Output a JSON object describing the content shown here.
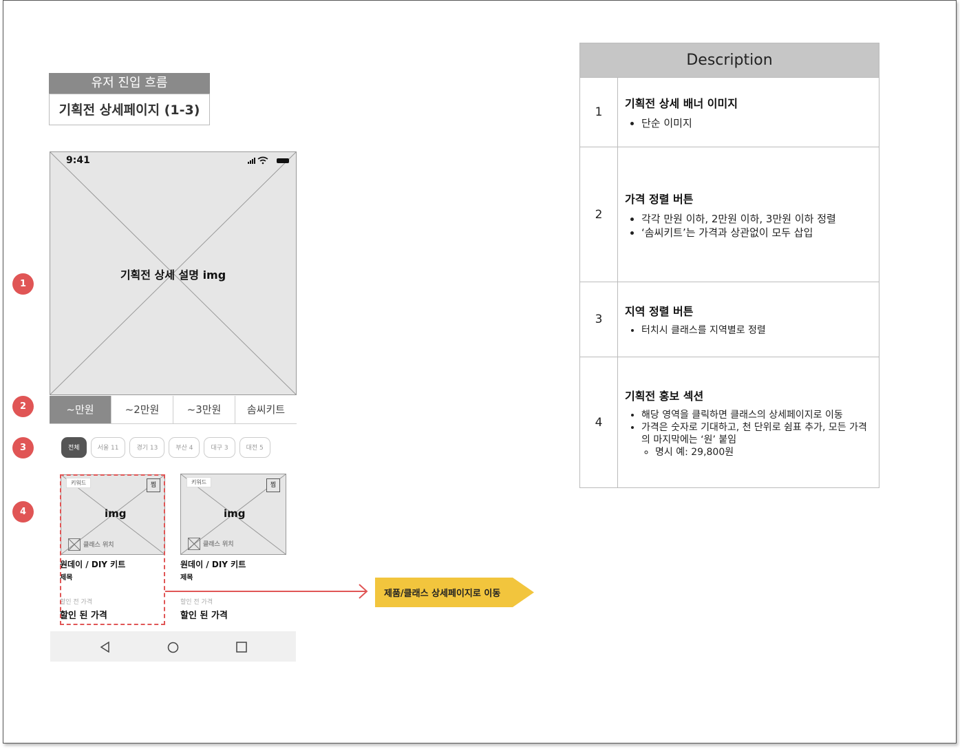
{
  "flow": {
    "header": "유저 진입 흐름",
    "page_title": "기획전 상세페이지 (1-3)"
  },
  "phone": {
    "status_time": "9:41",
    "banner_text": "기획전 상세 설명 img",
    "price_tabs": [
      "~만원",
      "~2만원",
      "~3만원",
      "솜씨키트"
    ],
    "region_chips": [
      "전체",
      "서울 11",
      "경기 13",
      "부산 4",
      "대구 3",
      "대전 5"
    ],
    "cards": [
      {
        "keyword": "키워드",
        "jjim": "찜",
        "img_text": "img",
        "location": "클래스 위치",
        "title": "원데이 / DIY 키트",
        "subtitle": "제목",
        "before_price": "할인 전 가격",
        "price": "할인 된 가격"
      },
      {
        "keyword": "키워드",
        "jjim": "찜",
        "img_text": "img",
        "location": "클래스 위치",
        "title": "원데이 / DIY 키트",
        "subtitle": "제목",
        "before_price": "할인 전 가격",
        "price": "할인 된 가격"
      }
    ],
    "nav_icons": [
      "back-icon",
      "home-icon",
      "recents-icon"
    ]
  },
  "badges": [
    "1",
    "2",
    "3",
    "4"
  ],
  "flow_arrow": {
    "label": "제품/클래스 상세페이지로 이동",
    "color": "#f2c53d",
    "line_color": "#e05555"
  },
  "description": {
    "header": "Description",
    "rows": [
      {
        "num": "1",
        "title": "기획전 상세 배너 이미지",
        "items": [
          "단순 이미지"
        ]
      },
      {
        "num": "2",
        "title": "가격 정렬 버튼",
        "items": [
          "각각 만원 이하, 2만원 이하, 3만원 이하 정렬",
          "‘솜씨키트’는 가격과 상관없이 모두 삽입"
        ]
      },
      {
        "num": "3",
        "title": "지역 정렬 버튼",
        "items": [
          "터치시 클래스를 지역별로 정렬"
        ]
      },
      {
        "num": "4",
        "title": "기획전 홍보 섹션",
        "items": [
          "해당 영역을 클릭하면 클래스의 상세페이지로 이동",
          "가격은 숫자로 기대하고, 천 단위로 쉼표 추가, 모든 가격의 마지막에는 ‘원’ 붙임"
        ],
        "subitems": [
          "명시 예: 29,800원"
        ]
      }
    ]
  },
  "colors": {
    "badge": "#e05555",
    "active_tab": "#8a8a8a",
    "table_header": "#c6c6c6"
  }
}
